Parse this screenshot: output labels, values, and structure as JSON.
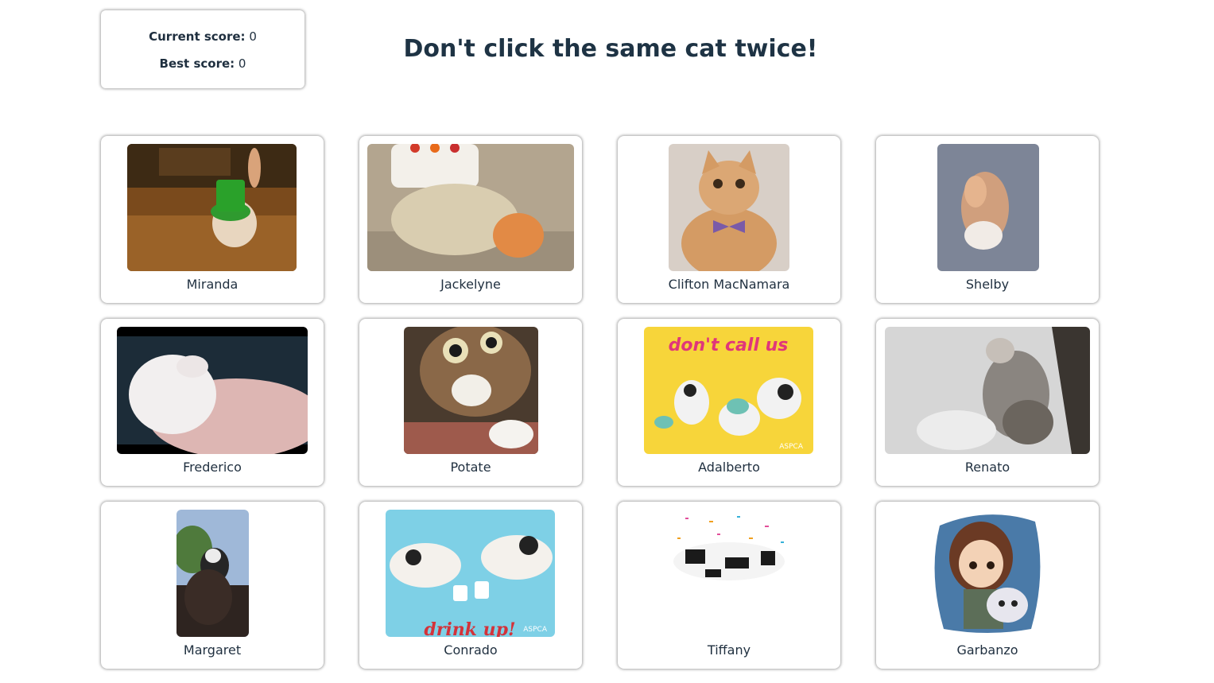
{
  "scoreboard": {
    "current_label": "Current score:",
    "current_value": "0",
    "best_label": "Best score:",
    "best_value": "0"
  },
  "title": "Don't click the same cat twice!",
  "cards": [
    {
      "name": "Miranda",
      "icon": "kitten-green-hat-image"
    },
    {
      "name": "Jackelyne",
      "icon": "kitten-in-turtle-costume-image"
    },
    {
      "name": "Clifton MacNamara",
      "icon": "cat-bowtie-image"
    },
    {
      "name": "Shelby",
      "icon": "cat-blur-image"
    },
    {
      "name": "Frederico",
      "icon": "white-cat-blanket-image"
    },
    {
      "name": "Potate",
      "icon": "tabby-kitten-closeup-image"
    },
    {
      "name": "Adalberto",
      "icon": "kittens-telephone-image",
      "overlay_text": "don't call us",
      "watermark": "ASPCA"
    },
    {
      "name": "Renato",
      "icon": "cat-climbing-snow-image"
    },
    {
      "name": "Margaret",
      "icon": "cat-on-shoulder-image"
    },
    {
      "name": "Conrado",
      "icon": "cats-drinking-cups-image",
      "overlay_text": "drink up!",
      "watermark": "ASPCA"
    },
    {
      "name": "Tiffany",
      "icon": "pixel-cat-confetti-image"
    },
    {
      "name": "Garbanzo",
      "icon": "girl-with-cat-drawing-image"
    }
  ]
}
